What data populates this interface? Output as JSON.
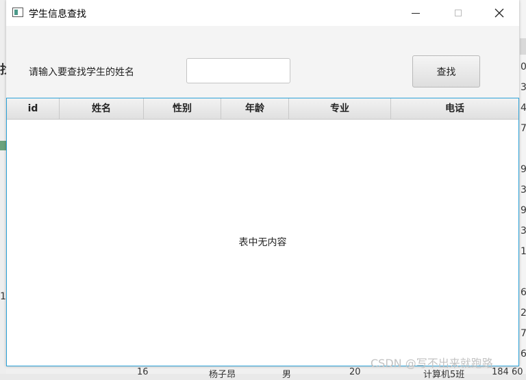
{
  "window": {
    "title": "学生信息查找"
  },
  "search": {
    "prompt": "请输入要查找学生的姓名",
    "input_value": "",
    "button_label": "查找"
  },
  "table": {
    "columns": [
      "id",
      "姓名",
      "性别",
      "年龄",
      "专业",
      "电话"
    ],
    "empty_text": "表中无内容"
  },
  "background": {
    "left_chars": [
      "找",
      "1"
    ],
    "right_chars": [
      "0",
      "3",
      "4",
      "7",
      "9",
      "3",
      "9",
      "3",
      "1",
      "6",
      "2",
      "7",
      "6"
    ],
    "bottom_row": [
      "16",
      "杨子昂",
      "男",
      "20",
      "计算机5班",
      "184 60"
    ]
  },
  "watermark": "CSDN @写不出来就跑路",
  "colors": {
    "table_border": "#2aa1d8",
    "window_bg": "#f4f4f4"
  }
}
